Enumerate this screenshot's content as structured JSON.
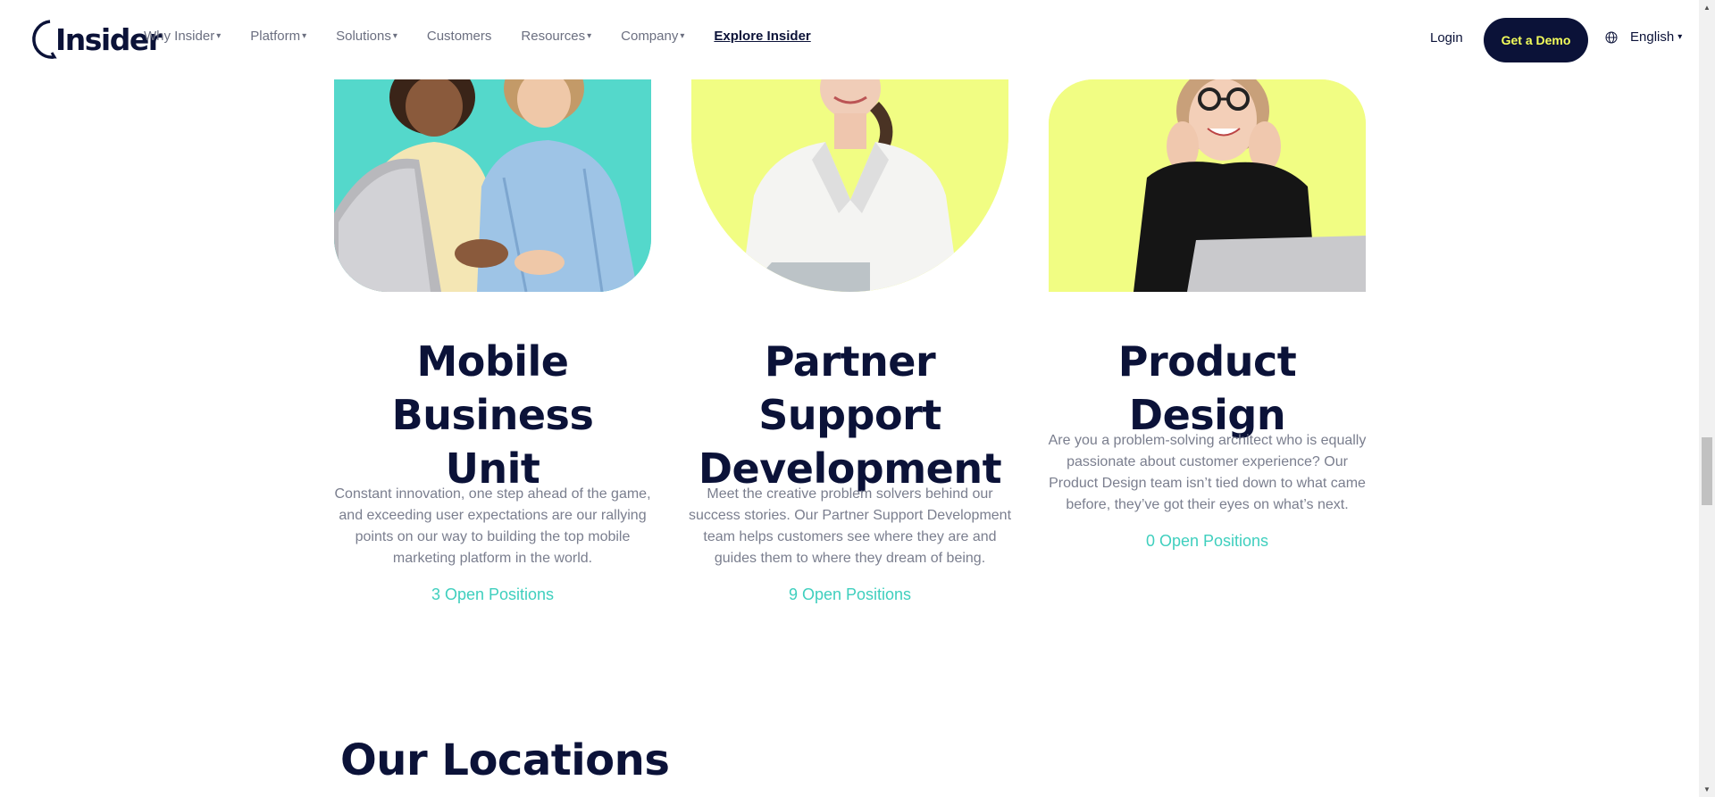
{
  "header": {
    "logo_text": "Insider",
    "nav": [
      {
        "label": "Why Insider",
        "caret": "▾"
      },
      {
        "label": "Platform",
        "caret": "▾"
      },
      {
        "label": "Solutions",
        "caret": "▾"
      },
      {
        "label": "Customers",
        "caret": ""
      },
      {
        "label": "Resources",
        "caret": "▾"
      },
      {
        "label": "Company",
        "caret": "▾"
      }
    ],
    "explore_label": "Explore Insider",
    "login_label": "Login",
    "demo_label": "Get a Demo",
    "language_label": "English",
    "language_caret": "▾"
  },
  "teams": [
    {
      "title_line1": "Mobile Business",
      "title_line2": "Unit",
      "description": "Constant innovation, one step ahead of the game, and exceeding user expectations are our rallying points on our way to building the top mobile marketing platform in the world.",
      "open_positions": "3 Open Positions"
    },
    {
      "title_line1": "Partner Support",
      "title_line2": "Development",
      "description": "Meet the creative problem solvers behind our success stories. Our Partner Support Development team helps customers see where they are and guides them to where they dream of being.",
      "open_positions": "9 Open Positions"
    },
    {
      "title_line1": "Product Design",
      "title_line2": "",
      "description": "Are you a problem-solving architect who is equally passionate about customer experience? Our Product Design team isn’t tied down to what came before, they’ve got their eyes on what’s next.",
      "open_positions": "0 Open Positions"
    }
  ],
  "locations_title": "Our Locations",
  "colors": {
    "navy": "#0b1238",
    "teal": "#3fcfbe",
    "yellow": "#f1fd83",
    "demo_text": "#f4ff5b"
  },
  "icons": {
    "globe": "globe-icon",
    "scroll_up": "▲",
    "scroll_down": "▼"
  }
}
